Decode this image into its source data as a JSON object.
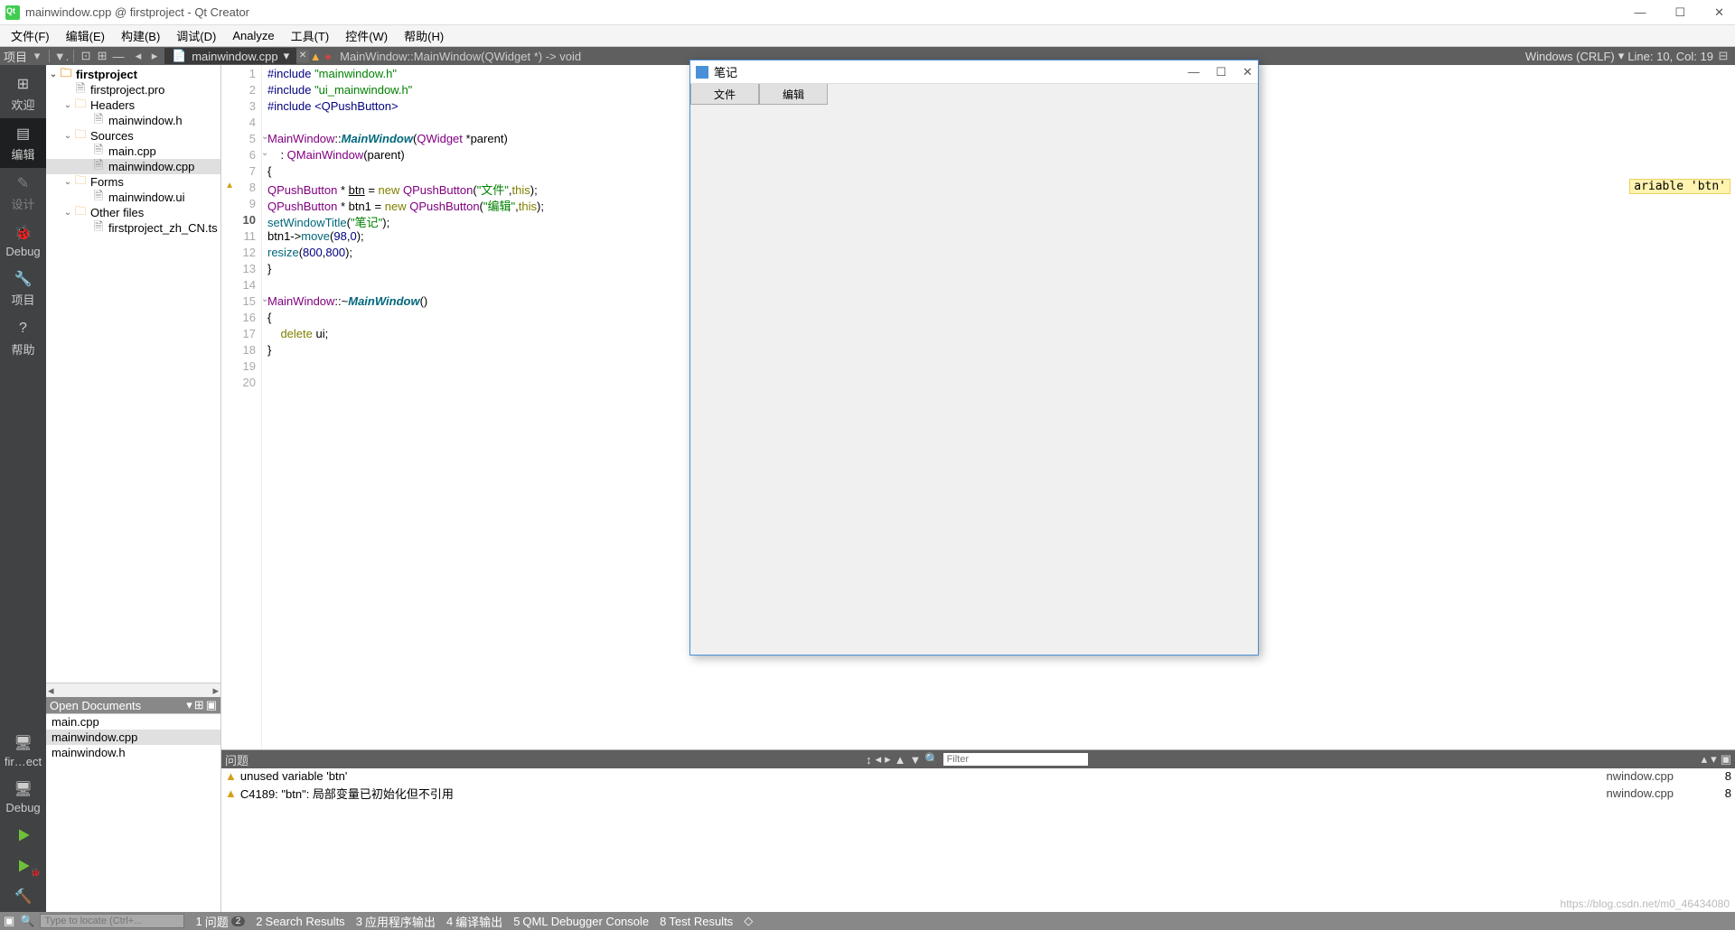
{
  "window": {
    "title": "mainwindow.cpp @ firstproject - Qt Creator"
  },
  "menubar": [
    "文件(F)",
    "编辑(E)",
    "构建(B)",
    "调试(D)",
    "Analyze",
    "工具(T)",
    "控件(W)",
    "帮助(H)"
  ],
  "toolbar": {
    "project_label": "项目",
    "doc": "mainwindow.cpp",
    "breadcrumb": "MainWindow::MainWindow(QWidget *) -> void",
    "encoding": "Windows (CRLF)",
    "pos": "Line: 10, Col: 19"
  },
  "leftbar": [
    {
      "label": "欢迎",
      "glyph": "⊞"
    },
    {
      "label": "编辑",
      "glyph": "▤",
      "active": true
    },
    {
      "label": "设计",
      "glyph": "✎",
      "dim": true
    },
    {
      "label": "Debug",
      "glyph": "🐞"
    },
    {
      "label": "项目",
      "glyph": "🔧"
    },
    {
      "label": "帮助",
      "glyph": "?"
    }
  ],
  "leftbar_bottom": {
    "project": "fir…ect",
    "mode": "Debug"
  },
  "project_tree": [
    {
      "lvl": 0,
      "open": true,
      "icon": "folder",
      "label": "firstproject",
      "bold": true
    },
    {
      "lvl": 1,
      "icon": "file",
      "label": "firstproject.pro"
    },
    {
      "lvl": 1,
      "open": true,
      "icon": "folder",
      "label": "Headers"
    },
    {
      "lvl": 2,
      "icon": "hfile",
      "label": "mainwindow.h"
    },
    {
      "lvl": 1,
      "open": true,
      "icon": "folder",
      "label": "Sources"
    },
    {
      "lvl": 2,
      "icon": "cfile",
      "label": "main.cpp"
    },
    {
      "lvl": 2,
      "icon": "cfile",
      "label": "mainwindow.cpp",
      "sel": true
    },
    {
      "lvl": 1,
      "open": true,
      "icon": "folder",
      "label": "Forms"
    },
    {
      "lvl": 2,
      "icon": "ufile",
      "label": "mainwindow.ui"
    },
    {
      "lvl": 1,
      "open": true,
      "icon": "folder",
      "label": "Other files"
    },
    {
      "lvl": 2,
      "icon": "file",
      "label": "firstproject_zh_CN.ts"
    }
  ],
  "open_docs": {
    "title": "Open Documents",
    "items": [
      "main.cpp",
      "mainwindow.cpp",
      "mainwindow.h"
    ],
    "sel": 1
  },
  "code_lines": [
    {
      "n": 1,
      "html": "<span class='mac'>#include</span> <span class='str'>\"mainwindow.h\"</span>"
    },
    {
      "n": 2,
      "html": "<span class='mac'>#include</span> <span class='str'>\"ui_mainwindow.h\"</span>"
    },
    {
      "n": 3,
      "html": "<span class='mac'>#include</span> <span class='inc'>&lt;QPushButton&gt;</span>",
      "hl": true
    },
    {
      "n": 4,
      "html": ""
    },
    {
      "n": 5,
      "html": "<span class='type'>MainWindow</span>::<span class='fn ital'>MainWindow</span>(<span class='type'>QWidget</span> *parent)",
      "fold": true
    },
    {
      "n": 6,
      "html": "    : <span class='type'>QMainWindow</span>(parent)",
      "fold": true
    },
    {
      "n": 7,
      "html": "{"
    },
    {
      "n": 8,
      "html": "<span class='type'>QPushButton</span> * <u>btn</u> = <span class='kw'>new</span> <span class='type'>QPushButton</span>(<span class='str'>\"文件\"</span>,<span class='this'>this</span>);",
      "warn": true
    },
    {
      "n": 9,
      "html": "<span class='type'>QPushButton</span> * btn1 = <span class='kw'>new</span> <span class='type'>QPushButton</span>(<span class='str'>\"编辑\"</span>,<span class='this'>this</span>);"
    },
    {
      "n": 10,
      "html": "<span class='fn'>setWindowTitle</span>(<span class='str'>\"笔记\"</span>);",
      "cur": true
    },
    {
      "n": 11,
      "html": "btn1-&gt;<span class='fn'>move</span>(<span class='num'>98</span>,<span class='num'>0</span>);"
    },
    {
      "n": 12,
      "html": "<span class='fn'>resize</span>(<span class='num'>800</span>,<span class='num'>800</span>);"
    },
    {
      "n": 13,
      "html": "}"
    },
    {
      "n": 14,
      "html": ""
    },
    {
      "n": 15,
      "html": "<span class='type'>MainWindow</span>::~<span class='fn ital'>MainWindow</span>()",
      "fold": true
    },
    {
      "n": 16,
      "html": "{"
    },
    {
      "n": 17,
      "html": "    <span class='kw'>delete</span> ui;"
    },
    {
      "n": 18,
      "html": "}"
    },
    {
      "n": 19,
      "html": ""
    },
    {
      "n": 20,
      "html": ""
    }
  ],
  "issues": {
    "title": "问题",
    "filter_ph": "Filter",
    "rows": [
      {
        "text": "unused variable 'btn'",
        "file": "nwindow.cpp",
        "line": "8"
      },
      {
        "text": "C4189: \"btn\": 局部变量已初始化但不引用",
        "file": "nwindow.cpp",
        "line": "8"
      }
    ]
  },
  "hint": "ariable 'btn'",
  "statusbar": {
    "locate_ph": "Type to locate (Ctrl+...",
    "tabs": [
      {
        "n": "1",
        "label": "问题",
        "badge": "2"
      },
      {
        "n": "2",
        "label": "Search Results"
      },
      {
        "n": "3",
        "label": "应用程序输出"
      },
      {
        "n": "4",
        "label": "编译输出"
      },
      {
        "n": "5",
        "label": "QML Debugger Console"
      },
      {
        "n": "8",
        "label": "Test Results"
      }
    ]
  },
  "popup": {
    "title": "笔记",
    "buttons": [
      "文件",
      "编辑"
    ]
  },
  "watermark": "https://blog.csdn.net/m0_46434080"
}
